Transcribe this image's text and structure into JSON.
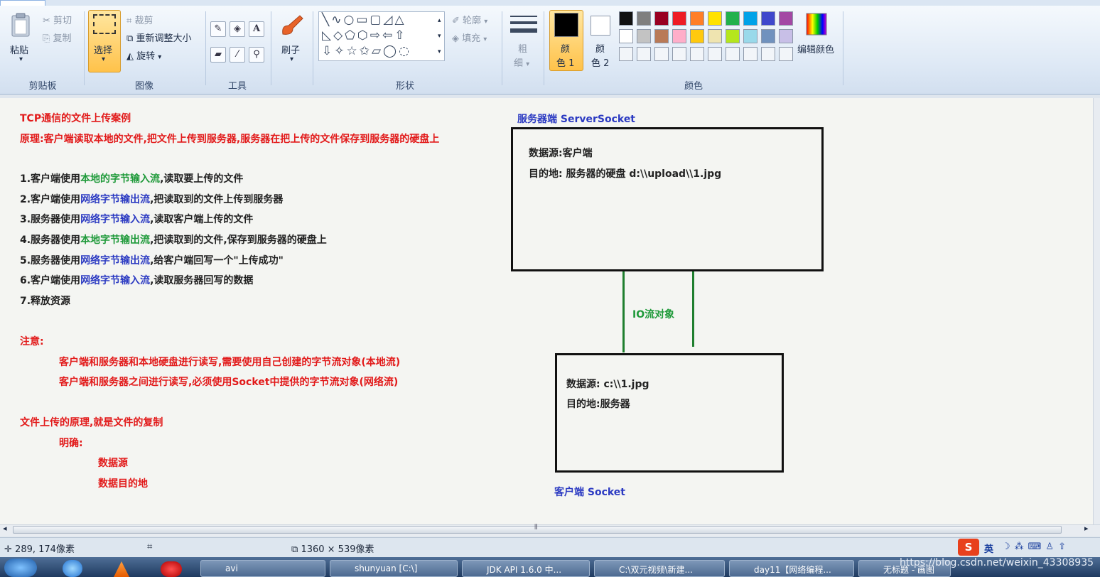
{
  "ribbon": {
    "clipboard": {
      "paste": "粘贴",
      "cut": "剪切",
      "copy": "复制",
      "group": "剪贴板"
    },
    "image": {
      "select": "选择",
      "crop": "裁剪",
      "resize": "重新调整大小",
      "rotate": "旋转",
      "group": "图像"
    },
    "tools": {
      "group": "工具"
    },
    "brush": {
      "label": "刷子"
    },
    "shapes": {
      "outline": "轮廓",
      "fill": "填充",
      "group": "形状"
    },
    "size": {
      "line1": "粗",
      "line2": "细"
    },
    "colors": {
      "color1_a": "颜",
      "color1_b": "色 1",
      "color2_a": "颜",
      "color2_b": "色 2",
      "edit": "编辑颜色",
      "group": "颜色",
      "palette_row1": [
        "#111111",
        "#7f7f7f",
        "#990022",
        "#ee1c24",
        "#ff7f27",
        "#ffe200",
        "#22b14c",
        "#00a2e8",
        "#3f48cc",
        "#a349a4"
      ],
      "palette_row2": [
        "#ffffff",
        "#c3c3c3",
        "#b97a57",
        "#ffaec9",
        "#ffc90e",
        "#efe4b0",
        "#b5e61d",
        "#99d9ea",
        "#7092be",
        "#c8bfe7"
      ]
    }
  },
  "canvas": {
    "title": "TCP通信的文件上传案例",
    "principle": "原理:客户端读取本地的文件,把文件上传到服务器,服务器在把上传的文件保存到服务器的硬盘上",
    "steps": [
      {
        "pre": "1.客户端使用",
        "hl": "本地的字节输入流",
        "post": ",读取要上传的文件",
        "hl_color": "green"
      },
      {
        "pre": "2.客户端使用",
        "hl": "网络字节输出流",
        "post": ",把读取到的文件上传到服务器",
        "hl_color": "blue"
      },
      {
        "pre": "3.服务器使用",
        "hl": "网络字节输入流",
        "post": ",读取客户端上传的文件",
        "hl_color": "blue"
      },
      {
        "pre": "4.服务器使用",
        "hl": "本地字节输出流",
        "post": ",把读取到的文件,保存到服务器的硬盘上",
        "hl_color": "green"
      },
      {
        "pre": "5.服务器使用",
        "hl": "网络字节输出流",
        "post": ",给客户端回写一个\"上传成功\"",
        "hl_color": "blue"
      },
      {
        "pre": "6.客户端使用",
        "hl": "网络字节输入流",
        "post": ",读取服务器回写的数据",
        "hl_color": "blue"
      },
      {
        "pre": "7.释放资源",
        "hl": "",
        "post": "",
        "hl_color": "none"
      }
    ],
    "note_label": "注意:",
    "note1": "客户端和服务器和本地硬盘进行读写,需要使用自己创建的字节流对象(本地流)",
    "note2": "客户端和服务器之间进行读写,必须使用Socket中提供的字节流对象(网络流)",
    "upload_principle": "文件上传的原理,就是文件的复制",
    "clarify": "明确:",
    "source": "数据源",
    "destination": "数据目的地",
    "server_title": "服务器端 ServerSocket",
    "server_source": "数据源:客户端",
    "server_dest": "目的地: 服务器的硬盘 d:\\\\upload\\\\1.jpg",
    "io_label": "IO流对象",
    "client_source": "数据源: c:\\\\1.jpg",
    "client_dest": "目的地:服务器",
    "client_title": "客户端 Socket"
  },
  "status": {
    "cursor": "289, 174像素",
    "size": "1360 × 539像素"
  },
  "taskbar": {
    "items": [
      "avi",
      "shunyuan [C:\\]",
      "JDK API 1.6.0 中...",
      "C:\\双元视频\\新建...",
      "day11【网络编程...",
      "无标题 - 画图"
    ],
    "ime": "英",
    "watermark": "https://blog.csdn.net/weixin_43308935"
  }
}
